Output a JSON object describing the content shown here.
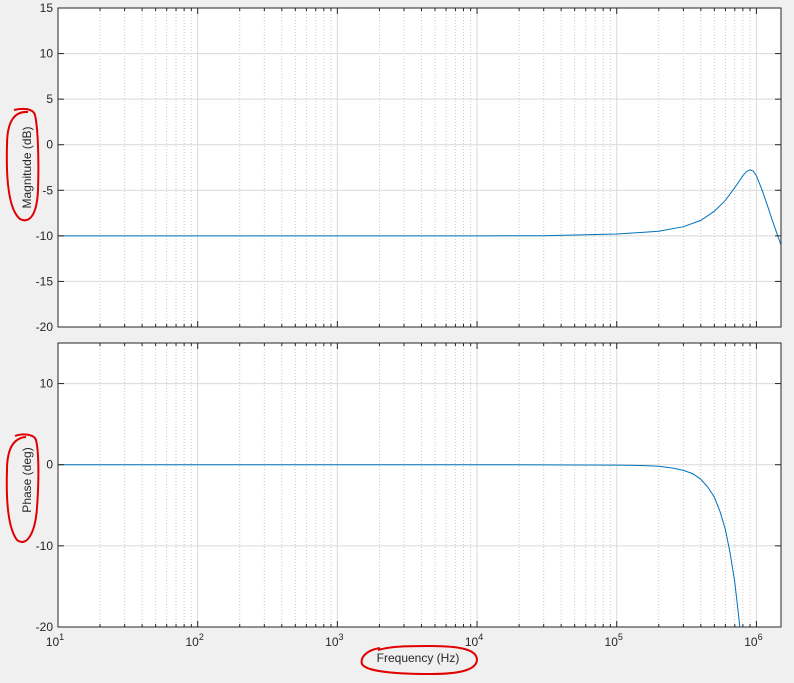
{
  "chart_data": [
    {
      "type": "line",
      "title": "",
      "xlabel": "",
      "ylabel": "Magnitude (dB)",
      "x_scale": "log",
      "xlim": [
        10,
        1500000
      ],
      "ylim": [
        -20,
        15
      ],
      "yticks": [
        15,
        10,
        5,
        0,
        -5,
        -10,
        -15,
        -20
      ],
      "grid": true,
      "series": [
        {
          "color": "#0072bd",
          "x": [
            10,
            1000,
            10000,
            30000,
            100000,
            200000,
            300000,
            400000,
            500000,
            600000,
            700000,
            800000,
            850000,
            900000,
            950000,
            1000000,
            1100000,
            1200000,
            1300000,
            1400000,
            1500000
          ],
          "y": [
            -10,
            -10,
            -10,
            -9.98,
            -9.8,
            -9.5,
            -9.0,
            -8.3,
            -7.3,
            -6.1,
            -4.7,
            -3.4,
            -2.95,
            -2.75,
            -2.9,
            -3.4,
            -5.0,
            -6.7,
            -8.3,
            -9.7,
            -11.0
          ]
        }
      ]
    },
    {
      "type": "line",
      "title": "",
      "xlabel": "Frequency  (Hz)",
      "ylabel": "Phase (deg)",
      "x_scale": "log",
      "xlim": [
        10,
        1500000
      ],
      "ylim": [
        -20,
        15
      ],
      "yticks": [
        10,
        0,
        -10,
        -20
      ],
      "xticks": [
        {
          "base": "10",
          "exp": "1",
          "value": 10
        },
        {
          "base": "10",
          "exp": "2",
          "value": 100
        },
        {
          "base": "10",
          "exp": "3",
          "value": 1000
        },
        {
          "base": "10",
          "exp": "4",
          "value": 10000
        },
        {
          "base": "10",
          "exp": "5",
          "value": 100000
        },
        {
          "base": "10",
          "exp": "6",
          "value": 1000000
        }
      ],
      "grid": true,
      "series": [
        {
          "color": "#0072bd",
          "x": [
            10,
            10000,
            100000,
            150000,
            200000,
            250000,
            300000,
            350000,
            400000,
            450000,
            500000,
            550000,
            600000,
            650000,
            700000,
            750000,
            760000
          ],
          "y": [
            0,
            0,
            -0.05,
            -0.1,
            -0.2,
            -0.4,
            -0.7,
            -1.1,
            -1.8,
            -2.8,
            -4.0,
            -5.8,
            -8.0,
            -11.0,
            -14.5,
            -19.0,
            -20.0
          ]
        }
      ]
    }
  ],
  "annotation_color": "#e00000"
}
